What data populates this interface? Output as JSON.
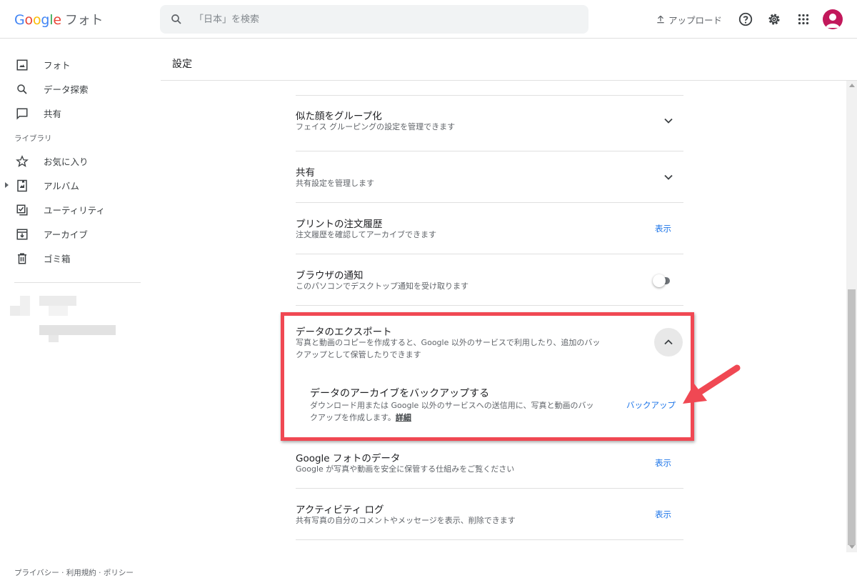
{
  "app": {
    "logo_letters": [
      "G",
      "o",
      "o",
      "g",
      "l",
      "e"
    ],
    "product": "フォト"
  },
  "search": {
    "placeholder": "「日本」を検索"
  },
  "topbar": {
    "upload_label": "アップロード"
  },
  "sidebar": {
    "items": [
      {
        "label": "フォト",
        "icon": "photo-icon"
      },
      {
        "label": "データ探索",
        "icon": "search-icon"
      },
      {
        "label": "共有",
        "icon": "chat-bubble-icon"
      }
    ],
    "library_label": "ライブラリ",
    "library_items": [
      {
        "label": "お気に入り",
        "icon": "star-icon"
      },
      {
        "label": "アルバム",
        "icon": "album-icon"
      },
      {
        "label": "ユーティリティ",
        "icon": "checklist-icon"
      },
      {
        "label": "アーカイブ",
        "icon": "archive-icon"
      },
      {
        "label": "ゴミ箱",
        "icon": "trash-icon"
      }
    ],
    "footer": "プライバシー · 利用規約 · ポリシー"
  },
  "page": {
    "title": "設定"
  },
  "settings": [
    {
      "title": "似た顔をグループ化",
      "subtitle": "フェイス グルーピングの設定を管理できます",
      "control": "chevron-down-icon"
    },
    {
      "title": "共有",
      "subtitle": "共有設定を管理します",
      "control": "chevron-down-icon"
    },
    {
      "title": "プリントの注文履歴",
      "subtitle": "注文履歴を確認してアーカイブできます",
      "action": "表示"
    },
    {
      "title": "ブラウザの通知",
      "subtitle": "このパソコンでデスクトップ通知を受け取ります",
      "control": "toggle-off"
    },
    {
      "title": "データのエクスポート",
      "subtitle_line1": "写真と動画のコピーを作成すると、Google 以外のサービスで利用したり、追加のバッ",
      "subtitle_line2": "クアップとして保管したりできます",
      "control": "chevron-up-icon",
      "expanded": {
        "title": "データのアーカイブをバックアップする",
        "subtitle_line1": "ダウンロード用または Google 以外のサービスへの送信用に、写真と動画のバッ",
        "subtitle_line2_text": "クアップを作成します。",
        "subtitle_link": "詳細",
        "action": "バックアップ"
      }
    },
    {
      "title": "Google フォトのデータ",
      "subtitle": "Google が写真や動画を安全に保管する仕組みをご覧ください",
      "action": "表示"
    },
    {
      "title": "アクティビティ ログ",
      "subtitle": "共有写真の自分のコメントやメッセージを表示、削除できます",
      "action": "表示"
    }
  ],
  "colors": {
    "accent": "#1a73e8",
    "highlight": "#f04853",
    "avatar": "#c2185b"
  }
}
